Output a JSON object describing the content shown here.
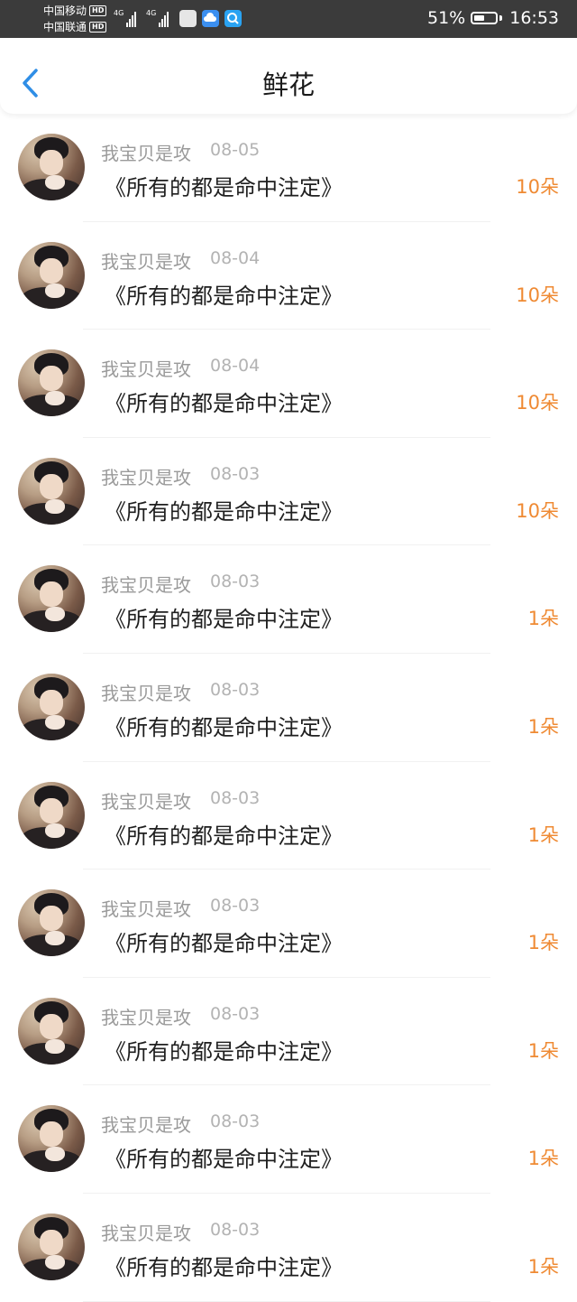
{
  "status_bar": {
    "carrier_1": "中国移动",
    "carrier_2": "中国联通",
    "hd_badge": "HD",
    "network_1": "4G",
    "network_2": "4G",
    "battery_percent": "51%",
    "battery_level": 0.51,
    "time": "16:53",
    "icons": [
      "huawei-app-icon",
      "cloud-icon",
      "search-app-icon"
    ]
  },
  "header": {
    "back_icon": "chevron-left-icon",
    "title": "鲜花"
  },
  "colors": {
    "accent_blue": "#2f8ee6",
    "count_orange": "#ef8a33",
    "status_bar_bg": "#3b3b3b"
  },
  "records": [
    {
      "name": "我宝贝是攻",
      "date": "08-05",
      "work": "《所有的都是命中注定》",
      "count": "10朵"
    },
    {
      "name": "我宝贝是攻",
      "date": "08-04",
      "work": "《所有的都是命中注定》",
      "count": "10朵"
    },
    {
      "name": "我宝贝是攻",
      "date": "08-04",
      "work": "《所有的都是命中注定》",
      "count": "10朵"
    },
    {
      "name": "我宝贝是攻",
      "date": "08-03",
      "work": "《所有的都是命中注定》",
      "count": "10朵"
    },
    {
      "name": "我宝贝是攻",
      "date": "08-03",
      "work": "《所有的都是命中注定》",
      "count": "1朵"
    },
    {
      "name": "我宝贝是攻",
      "date": "08-03",
      "work": "《所有的都是命中注定》",
      "count": "1朵"
    },
    {
      "name": "我宝贝是攻",
      "date": "08-03",
      "work": "《所有的都是命中注定》",
      "count": "1朵"
    },
    {
      "name": "我宝贝是攻",
      "date": "08-03",
      "work": "《所有的都是命中注定》",
      "count": "1朵"
    },
    {
      "name": "我宝贝是攻",
      "date": "08-03",
      "work": "《所有的都是命中注定》",
      "count": "1朵"
    },
    {
      "name": "我宝贝是攻",
      "date": "08-03",
      "work": "《所有的都是命中注定》",
      "count": "1朵"
    },
    {
      "name": "我宝贝是攻",
      "date": "08-03",
      "work": "《所有的都是命中注定》",
      "count": "1朵"
    }
  ]
}
